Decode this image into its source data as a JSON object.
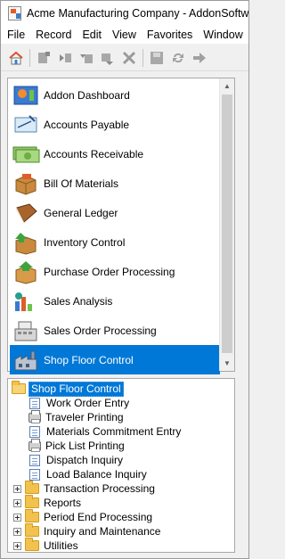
{
  "window": {
    "title": "Acme Manufacturing Company - AddonSoftware"
  },
  "menubar": {
    "items": [
      {
        "label": "File"
      },
      {
        "label": "Record"
      },
      {
        "label": "Edit"
      },
      {
        "label": "View"
      },
      {
        "label": "Favorites"
      },
      {
        "label": "Window"
      }
    ]
  },
  "toolbar": {
    "buttons": [
      {
        "icon": "home-icon"
      },
      {
        "icon": "new-record-icon"
      },
      {
        "icon": "first-record-icon"
      },
      {
        "icon": "previous-record-icon"
      },
      {
        "icon": "next-record-icon"
      },
      {
        "icon": "delete-icon"
      },
      {
        "icon": "save-icon"
      },
      {
        "icon": "refresh-icon"
      },
      {
        "icon": "forward-icon"
      }
    ]
  },
  "nav_list": {
    "items": [
      {
        "label": "Addon Dashboard",
        "icon": "dashboard-icon",
        "selected": false
      },
      {
        "label": "Accounts Payable",
        "icon": "check-icon",
        "selected": false
      },
      {
        "label": "Accounts Receivable",
        "icon": "money-icon",
        "selected": false
      },
      {
        "label": "Bill Of Materials",
        "icon": "box-icon",
        "selected": false
      },
      {
        "label": "General Ledger",
        "icon": "ledger-book-icon",
        "selected": false
      },
      {
        "label": "Inventory Control",
        "icon": "inventory-box-icon",
        "selected": false
      },
      {
        "label": "Purchase Order Processing",
        "icon": "purchase-box-icon",
        "selected": false
      },
      {
        "label": "Sales Analysis",
        "icon": "sales-chart-icon",
        "selected": false
      },
      {
        "label": "Sales Order Processing",
        "icon": "cash-register-icon",
        "selected": false
      },
      {
        "label": "Shop Floor Control",
        "icon": "factory-icon",
        "selected": true
      }
    ]
  },
  "tree": {
    "root": {
      "label": "Shop Floor Control",
      "selected": true
    },
    "tasks": [
      {
        "label": "Work Order Entry",
        "icon": "document-icon"
      },
      {
        "label": "Traveler Printing",
        "icon": "printer-icon"
      },
      {
        "label": "Materials Commitment Entry",
        "icon": "document-icon"
      },
      {
        "label": "Pick List Printing",
        "icon": "printer-icon"
      },
      {
        "label": "Dispatch Inquiry",
        "icon": "document-icon"
      },
      {
        "label": "Load Balance Inquiry",
        "icon": "document-icon"
      }
    ],
    "folders": [
      {
        "label": "Transaction Processing"
      },
      {
        "label": "Reports"
      },
      {
        "label": "Period End Processing"
      },
      {
        "label": "Inquiry and Maintenance"
      },
      {
        "label": "Utilities"
      }
    ]
  },
  "colors": {
    "selection": "#0078d7",
    "folder": "#f2c24e"
  }
}
